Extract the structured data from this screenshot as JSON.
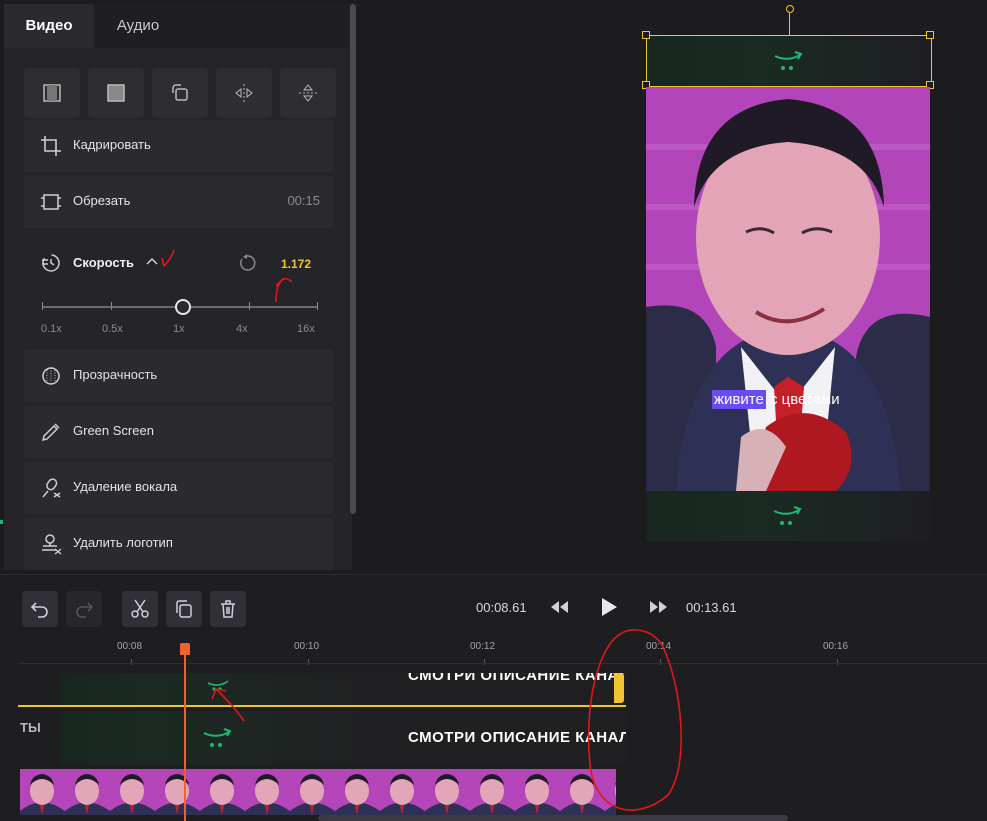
{
  "tabs": {
    "video": "Видео",
    "audio": "Аудио"
  },
  "tools": [
    "aspect-icon",
    "fill-icon",
    "rotate-icon",
    "flip-horizontal-icon",
    "flip-vertical-icon"
  ],
  "rows": {
    "crop": "Кадрировать",
    "trim": "Обрезать",
    "trim_duration": "00:15",
    "speed": "Скорость",
    "speed_value": "1.172",
    "speed_marks": [
      "0.1x",
      "0.5x",
      "1x",
      "4x",
      "16x"
    ],
    "speed_slider_position": 0.5,
    "opacity": "Прозрачность",
    "green_screen": "Green Screen",
    "vocal_removal": "Удаление вокала",
    "logo_removal": "Удалить логотип"
  },
  "preview": {
    "subtitle_highlight": "живите",
    "subtitle_rest": " с цветами"
  },
  "transport": {
    "current_time": "00:08.61",
    "end_time": "00:13.61"
  },
  "ruler": [
    "00:08",
    "00:10",
    "00:12",
    "00:14",
    "00:16"
  ],
  "tracks": {
    "text_overlay": "СМОТРИ ОПИСАНИЕ КАНАЛА",
    "track_label_cut": "ТЫ"
  },
  "colors": {
    "accent_yellow": "#f2c430",
    "playhead": "#f0622b",
    "subtitle_bg": "#6a4df0",
    "cart_green": "#1fb873"
  }
}
